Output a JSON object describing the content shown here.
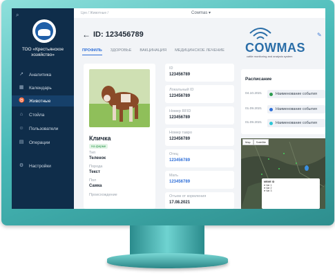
{
  "sidebar": {
    "org_name": "ТОО «Крестьянское хозяйство»",
    "items": [
      {
        "label": "Аналитика",
        "icon": "chart-icon"
      },
      {
        "label": "Календарь",
        "icon": "calendar-icon"
      },
      {
        "label": "Животные",
        "icon": "animal-icon",
        "active": true
      },
      {
        "label": "Стойла",
        "icon": "barn-icon"
      },
      {
        "label": "Пользователи",
        "icon": "users-icon"
      },
      {
        "label": "Операции",
        "icon": "operations-icon"
      },
      {
        "label": "Настройки",
        "icon": "gear-icon"
      }
    ]
  },
  "topbar": {
    "breadcrumb": "Цех / Животные /",
    "app_title": "Cowmas"
  },
  "header": {
    "title": "ID: 123456789"
  },
  "tabs": [
    "ПРОФИЛЬ",
    "ЗДОРОВЬЕ",
    "ВАКЦИНАЦИЯ",
    "МЕДИЦИНСКОЕ ЛЕЧЕНИЕ"
  ],
  "profile": {
    "name": "Кличка",
    "status_badge": "На ферме",
    "fields": [
      {
        "label": "Тип",
        "value": "Теленок"
      },
      {
        "label": "Порода",
        "value": "Текст"
      },
      {
        "label": "Пол",
        "value": "Самка"
      },
      {
        "label": "Происхождение",
        "value": ""
      }
    ]
  },
  "details": [
    {
      "label": "ID",
      "value": "123456789",
      "link": false
    },
    {
      "label": "Локальный ID",
      "value": "123456789",
      "link": false
    },
    {
      "label": "Номер RFID",
      "value": "123456789",
      "link": false
    },
    {
      "label": "Номер тавро",
      "value": "123456789",
      "link": false
    },
    {
      "label": "Отец",
      "value": "123456789",
      "link": true
    },
    {
      "label": "Мать",
      "value": "123456789",
      "link": true
    },
    {
      "label": "Отъем от кормления",
      "value": "17.08.2021",
      "link": false
    }
  ],
  "schedule": {
    "title": "Расписание",
    "events": [
      {
        "date": "04.10.2021",
        "label": "Наименование события",
        "color": "#2e9b4f"
      },
      {
        "date": "01.09.2021",
        "label": "Наименование события",
        "color": "#2f6fd8"
      },
      {
        "date": "01.09.2021",
        "label": "Наименование события",
        "color": "#2ec6d6"
      }
    ]
  },
  "map": {
    "controls": [
      "Map",
      "Satellite"
    ]
  },
  "brand": {
    "name": "COWMAS",
    "tagline": "cattle monitoring and analysis system"
  },
  "colors": {
    "sidebar_bg": "#0f2d4a",
    "accent": "#2f6fd8",
    "monitor": "#47b9b7"
  }
}
